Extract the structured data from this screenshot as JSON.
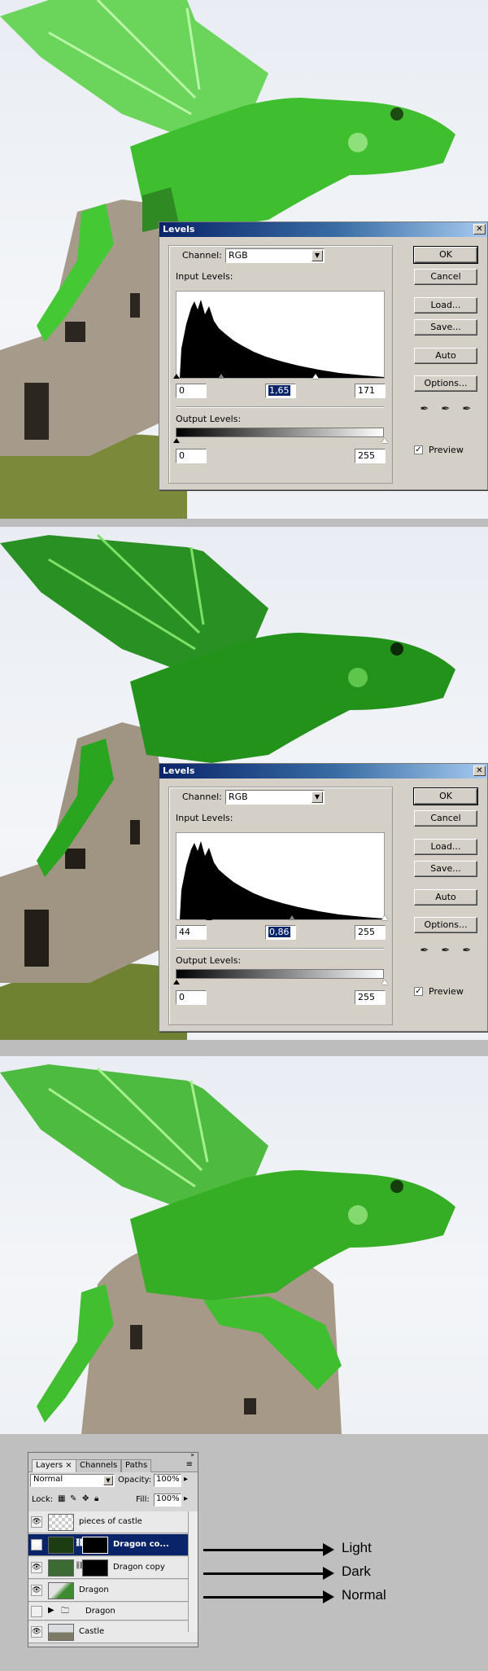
{
  "levels_dialog": {
    "title": "Levels",
    "close_icon": "close-icon",
    "channel_label": "Channel:",
    "channel_value": "RGB",
    "input_levels_label": "Input Levels:",
    "output_levels_label": "Output Levels:",
    "buttons": {
      "ok": "OK",
      "cancel": "Cancel",
      "load": "Load...",
      "save": "Save...",
      "auto": "Auto",
      "options": "Options..."
    },
    "preview_label": "Preview",
    "preview_checked": true,
    "eyedroppers": [
      "black-eyedropper-icon",
      "gray-eyedropper-icon",
      "white-eyedropper-icon"
    ]
  },
  "step1": {
    "input_black": "0",
    "input_gamma": "1,65",
    "input_white": "171",
    "output_black": "0",
    "output_white": "255"
  },
  "step2": {
    "input_black": "44",
    "input_gamma": "0,86",
    "input_white": "255",
    "output_black": "0",
    "output_white": "255"
  },
  "layers_panel": {
    "tabs": [
      "Layers",
      "Channels",
      "Paths"
    ],
    "blend_mode": "Normal",
    "opacity_label": "Opacity:",
    "opacity_value": "100%",
    "lock_label": "Lock:",
    "fill_label": "Fill:",
    "fill_value": "100%",
    "layers": [
      {
        "name": "pieces of castle",
        "visible": true,
        "selected": false
      },
      {
        "name": "Dragon co...",
        "visible": true,
        "selected": true
      },
      {
        "name": "Dragon copy",
        "visible": true,
        "selected": false
      },
      {
        "name": "Dragon",
        "visible": true,
        "selected": false
      },
      {
        "name": "Dragon",
        "visible": false,
        "selected": false,
        "group": true
      },
      {
        "name": "Castle",
        "visible": true,
        "selected": false
      }
    ]
  },
  "annotations": [
    "Light",
    "Dark",
    "Normal"
  ],
  "colors": {
    "dialog_bg": "#d4d0c8",
    "titlebar_start": "#0a246a",
    "selection": "#0a246a",
    "dragon_green": "#3fbf2f"
  }
}
